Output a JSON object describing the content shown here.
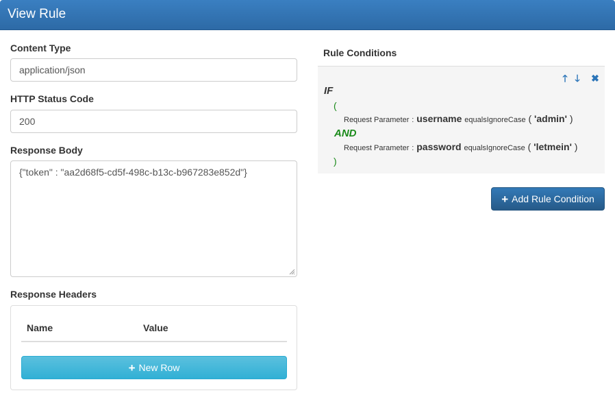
{
  "window": {
    "title": "View Rule"
  },
  "form": {
    "content_type_label": "Content Type",
    "content_type_value": "application/json",
    "status_code_label": "HTTP Status Code",
    "status_code_value": "200",
    "response_body_label": "Response Body",
    "response_body_value": "{\"token\" : \"aa2d68f5-cd5f-498c-b13c-b967283e852d\"}",
    "response_headers_label": "Response Headers",
    "headers_table": {
      "columns": [
        "Name",
        "Value"
      ]
    },
    "new_row_label": "New Row"
  },
  "rules": {
    "title": "Rule Conditions",
    "if_keyword": "IF",
    "open_paren": "(",
    "close_paren": ")",
    "and_keyword": "AND",
    "conditions": [
      {
        "source": "Request Parameter",
        "sep": ":",
        "field": "username",
        "operator": "equalsIgnoreCase",
        "open": "(",
        "value": "'admin'",
        "close": ")"
      },
      {
        "source": "Request Parameter",
        "sep": ":",
        "field": "password",
        "operator": "equalsIgnoreCase",
        "open": "(",
        "value": "'letmein'",
        "close": ")"
      }
    ],
    "add_condition_label": "Add Rule Condition",
    "icons": [
      "arrow-up-icon",
      "arrow-down-icon",
      "close-icon"
    ]
  },
  "colors": {
    "primary": "#337ab7",
    "info": "#5bc0de",
    "and_green": "#1a8a1a",
    "title_bar": "#3a7fc1"
  }
}
